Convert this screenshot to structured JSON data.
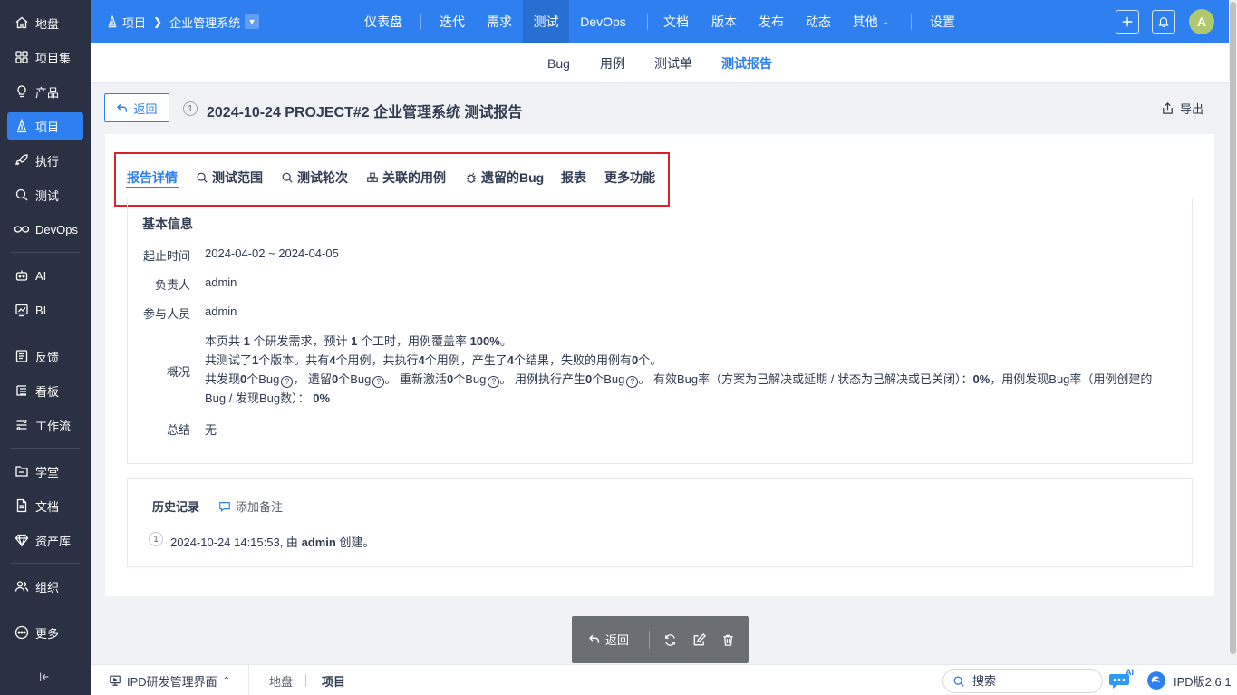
{
  "sidebar": {
    "items": [
      {
        "label": "地盘",
        "icon": "home-icon"
      },
      {
        "label": "项目集",
        "icon": "grid-icon"
      },
      {
        "label": "产品",
        "icon": "bulb-icon"
      },
      {
        "label": "项目",
        "icon": "project-icon"
      },
      {
        "label": "执行",
        "icon": "rocket-icon"
      },
      {
        "label": "测试",
        "icon": "search-icon"
      },
      {
        "label": "DevOps",
        "icon": "infinity-icon"
      },
      {
        "label": "AI",
        "icon": "robot-icon"
      },
      {
        "label": "BI",
        "icon": "chart-icon"
      },
      {
        "label": "反馈",
        "icon": "feedback-icon"
      },
      {
        "label": "看板",
        "icon": "kanban-icon"
      },
      {
        "label": "工作流",
        "icon": "workflow-icon"
      },
      {
        "label": "学堂",
        "icon": "school-icon"
      },
      {
        "label": "文档",
        "icon": "doc-icon"
      },
      {
        "label": "资产库",
        "icon": "diamond-icon"
      },
      {
        "label": "组织",
        "icon": "users-icon"
      },
      {
        "label": "更多",
        "icon": "more-icon"
      }
    ],
    "active": "项目"
  },
  "topbar": {
    "crumb_root": "项目",
    "crumb_current": "企业管理系统",
    "nav": [
      "仪表盘",
      "迭代",
      "需求",
      "测试",
      "DevOps",
      "文档",
      "版本",
      "发布",
      "动态",
      "其他",
      "设置"
    ],
    "active_nav": "测试",
    "avatar_letter": "A"
  },
  "subnav": {
    "items": [
      "Bug",
      "用例",
      "测试单",
      "测试报告"
    ],
    "active": "测试报告"
  },
  "header": {
    "back_label": "返回",
    "id": "1",
    "title": "2024-10-24 PROJECT#2 企业管理系统 测试报告",
    "export_label": "导出"
  },
  "tabs": [
    {
      "label": "报告详情",
      "icon": ""
    },
    {
      "label": "测试范围",
      "icon": "search-icon"
    },
    {
      "label": "测试轮次",
      "icon": "search-icon"
    },
    {
      "label": "关联的用例",
      "icon": "cases-icon"
    },
    {
      "label": "遗留的Bug",
      "icon": "bug-icon"
    },
    {
      "label": "报表",
      "icon": ""
    },
    {
      "label": "更多功能",
      "icon": ""
    }
  ],
  "basic_info": {
    "title": "基本信息",
    "period_label": "起止时间",
    "period_value": "2024-04-02 ~ 2024-04-05",
    "owner_label": "负责人",
    "owner_value": "admin",
    "members_label": "参与人员",
    "members_value": "admin",
    "overview_label": "概况",
    "overview": {
      "l1_a": "本页共 ",
      "l1_b": "1",
      "l1_c": " 个研发需求，预计 ",
      "l1_d": "1",
      "l1_e": " 个工时，用例覆盖率 ",
      "l1_f": "100%",
      "l1_g": "。",
      "l2_a": "共测试了",
      "l2_b": "1",
      "l2_c": "个版本。共有",
      "l2_d": "4",
      "l2_e": "个用例，共执行",
      "l2_f": "4",
      "l2_g": "个用例，产生了",
      "l2_h": "4",
      "l2_i": "个结果，失败的用例有",
      "l2_j": "0",
      "l2_k": "个。",
      "l3_a": "共发现",
      "l3_b": "0",
      "l3_c": "个Bug",
      "l3_d": "， 遗留",
      "l3_e": "0",
      "l3_f": "个Bug",
      "l3_g": "。 重新激活",
      "l3_h": "0",
      "l3_i": "个Bug",
      "l3_j": "。 用例执行产生",
      "l3_k": "0",
      "l3_l": "个Bug",
      "l3_m": "。 有效Bug率（方案为已解决或延期 / 状态为已解决或已关闭）：",
      "l3_n": "0%",
      "l3_o": "，用例发现Bug率（用例创建的",
      "l4_a": "Bug / 发现Bug数）： ",
      "l4_b": "0%"
    },
    "summary_label": "总结",
    "summary_value": "无"
  },
  "history": {
    "title": "历史记录",
    "add_note": "添加备注",
    "entries": [
      {
        "num": "1",
        "time": "2024-10-24 14:15:53, 由 ",
        "user": "admin",
        "action": " 创建。"
      }
    ]
  },
  "actionbar": {
    "back_label": "返回"
  },
  "bottombar": {
    "ipd_label": "IPD研发管理界面",
    "crumb1": "地盘",
    "crumb2": "项目",
    "search_placeholder": "搜索",
    "ai_label": "AI",
    "version": "IPD版2.6.1"
  },
  "colors": {
    "primary": "#2e7ff0",
    "sidebar_bg": "#2a3142",
    "highlight_border": "#d9232b"
  }
}
